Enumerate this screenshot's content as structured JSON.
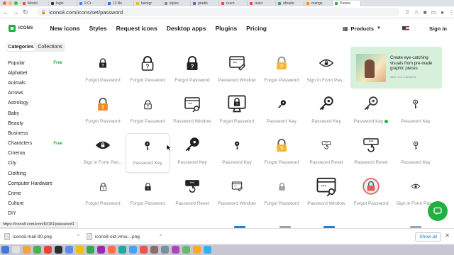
{
  "browser": {
    "tabs": [
      {
        "label": "Modul",
        "favicon_color": "#e05a2b"
      },
      {
        "label": "login",
        "favicon_color": "#333333"
      },
      {
        "label": "9 Cr",
        "favicon_color": "#4285f4"
      },
      {
        "label": "12 Be",
        "favicon_color": "#1a73e8"
      },
      {
        "label": "backgr",
        "favicon_color": "#f4b400"
      },
      {
        "label": "styles",
        "favicon_color": "#888888"
      },
      {
        "label": "gradie",
        "favicon_color": "#7d4fd6"
      },
      {
        "label": "react-",
        "favicon_color": "#e8453c"
      },
      {
        "label": "react",
        "favicon_color": "#e8453c"
      },
      {
        "label": "obrado",
        "favicon_color": "#1fb141"
      },
      {
        "label": "orange",
        "favicon_color": "#f28b20"
      },
      {
        "label": "Passw",
        "favicon_color": "#1fb141"
      }
    ],
    "url": "icons8.com/icons/set/password"
  },
  "site": {
    "logo": "ICONS",
    "nav": [
      "New icons",
      "Styles",
      "Request icons",
      "Desktop apps",
      "Plugins",
      "Pricing"
    ],
    "products": "Products",
    "sign_in": "Sign in"
  },
  "sidebar": {
    "tab_categories": "Categories",
    "tab_collections": "Collections",
    "categories": [
      {
        "label": "Popular",
        "badge": "Free"
      },
      {
        "label": "Alphabet",
        "badge": ""
      },
      {
        "label": "Animals",
        "badge": ""
      },
      {
        "label": "Arrows",
        "badge": ""
      },
      {
        "label": "Astrology",
        "badge": ""
      },
      {
        "label": "Baby",
        "badge": ""
      },
      {
        "label": "Beauty",
        "badge": ""
      },
      {
        "label": "Business",
        "badge": ""
      },
      {
        "label": "Characters",
        "badge": "Free"
      },
      {
        "label": "Cinema",
        "badge": ""
      },
      {
        "label": "City",
        "badge": ""
      },
      {
        "label": "Clothing",
        "badge": ""
      },
      {
        "label": "Computer Hardware",
        "badge": ""
      },
      {
        "label": "Crime",
        "badge": ""
      },
      {
        "label": "Culture",
        "badge": ""
      },
      {
        "label": "DIY",
        "badge": ""
      }
    ]
  },
  "icons": [
    {
      "label": "Forgot Password",
      "icon": "lock-question-small-icon"
    },
    {
      "label": "Forgot Password",
      "icon": "lock-question-outline-icon"
    },
    {
      "label": "Forgot Password",
      "icon": "lock-question-filled-icon"
    },
    {
      "label": "Password Window",
      "icon": "password-window-pen-icon"
    },
    {
      "label": "Forgot Password",
      "icon": "lock-question-color-icon"
    },
    {
      "label": "Sign in Form Pas...",
      "icon": "eye-lock-icon"
    },
    {
      "label": "Forgot Password",
      "icon": "lock-question-orange-icon"
    },
    {
      "label": "Forgot Password",
      "icon": "lock-question-small-outline-icon"
    },
    {
      "label": "Password Window",
      "icon": "password-window-key-icon"
    },
    {
      "label": "Forgot Password",
      "icon": "computer-lock-question-icon"
    },
    {
      "label": "Password Key",
      "icon": "key-small-icon"
    },
    {
      "label": "Password Key",
      "icon": "key-outline-icon"
    },
    {
      "label": "Password Key",
      "icon": "key-outline-thin-icon",
      "dot": true
    },
    {
      "label": "Password Key",
      "icon": "key-horizontal-icon"
    },
    {
      "label": "Sign in Form Pas...",
      "icon": "eye-lock-filled-icon"
    },
    {
      "label": "Password Key",
      "icon": "key-horizontal-filled-icon"
    },
    {
      "label": "Password Key",
      "icon": "key-filled-icon"
    },
    {
      "label": "Password Key",
      "icon": "key-horizontal-small-icon"
    },
    {
      "label": "Forgot Password",
      "icon": "lock-question-gold-icon"
    },
    {
      "label": "Password Reset",
      "icon": "password-reset-small-icon"
    },
    {
      "label": "Password Reset",
      "icon": "password-reset-dots-icon"
    },
    {
      "label": "Password Key",
      "icon": "key-horizontal-outline-icon"
    },
    {
      "label": "Forgot Password",
      "icon": "lock-question-tiny-icon"
    },
    {
      "label": "Forgot Password",
      "icon": "lock-question-tiny-filled-icon"
    },
    {
      "label": "Password Reset",
      "icon": "password-reset-filled-icon"
    },
    {
      "label": "Password Window",
      "icon": "password-window-small-icon"
    },
    {
      "label": "Forgot Password",
      "icon": "lock-question-grey-icon"
    },
    {
      "label": "Password Window",
      "icon": "password-window-key-outline-icon"
    },
    {
      "label": "Forgot Password",
      "icon": "lock-question-circle-color-icon"
    },
    {
      "label": "Sign in Form Pas...",
      "icon": "eye-lock-outline-icon"
    }
  ],
  "ad": {
    "text": "Create eye-catching visuals from pre-made graphic pieces",
    "sponsor": "ADS VIA CARBON"
  },
  "status_url": "https://icons8.com/icon/83181/password1",
  "downloads": {
    "items": [
      "icons8-mail-90.png",
      "icons8-old-vmw....png"
    ],
    "show_all": "Show all"
  },
  "colors": {
    "brand_green": "#1fb141",
    "ad_bg": "#d7f0dc",
    "lock_gold": "#f7b731",
    "lock_orange": "#f28b20"
  }
}
